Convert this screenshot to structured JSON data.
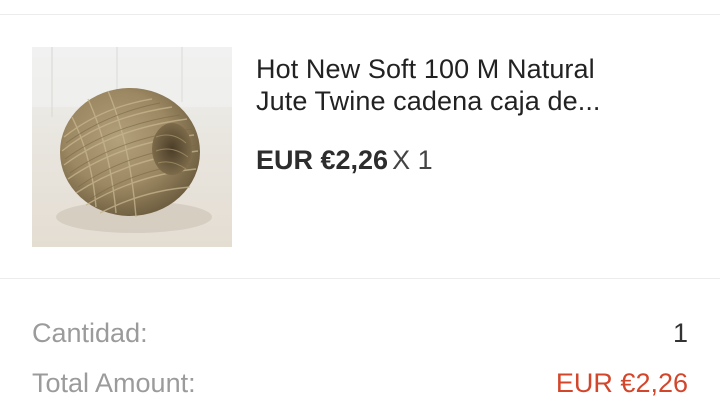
{
  "product": {
    "title_line1": "Hot New Soft 100 M Natural",
    "title_line2": "Jute Twine cadena caja de...",
    "price": "EUR €2,26",
    "quantity_multiplier": "X 1",
    "image_icon": "jute-twine-ball-image"
  },
  "summary": {
    "quantity_label": "Cantidad:",
    "quantity_value": "1",
    "total_label": "Total Amount:",
    "total_value": "EUR €2,26"
  },
  "colors": {
    "accent_total": "#d2462c",
    "label_gray": "#9b9b9b",
    "divider": "#ececec"
  }
}
